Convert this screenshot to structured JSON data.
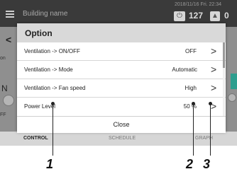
{
  "header": {
    "building_name": "Building name",
    "datetime": "2018/11/16 Fri. 22:34",
    "power_count": "127",
    "alarm_count": "0",
    "power_icon": "power-icon",
    "alarm_icon": "warning-icon"
  },
  "background": {
    "left_tab_label": "on",
    "left_on_text": "N",
    "left_off_text": "FF",
    "tabs": [
      "CONTROL",
      "SCHEDULE",
      "GRAPH"
    ]
  },
  "dialog": {
    "title": "Option",
    "rows": [
      {
        "label": "Ventilation -> ON/OFF",
        "value": "OFF"
      },
      {
        "label": "Ventilation -> Mode",
        "value": "Automatic"
      },
      {
        "label": "Ventilation -> Fan speed",
        "value": "High"
      },
      {
        "label": "Power Level",
        "value": "50 %"
      }
    ],
    "close_label": "Close"
  },
  "callouts": [
    "1",
    "2",
    "3"
  ]
}
